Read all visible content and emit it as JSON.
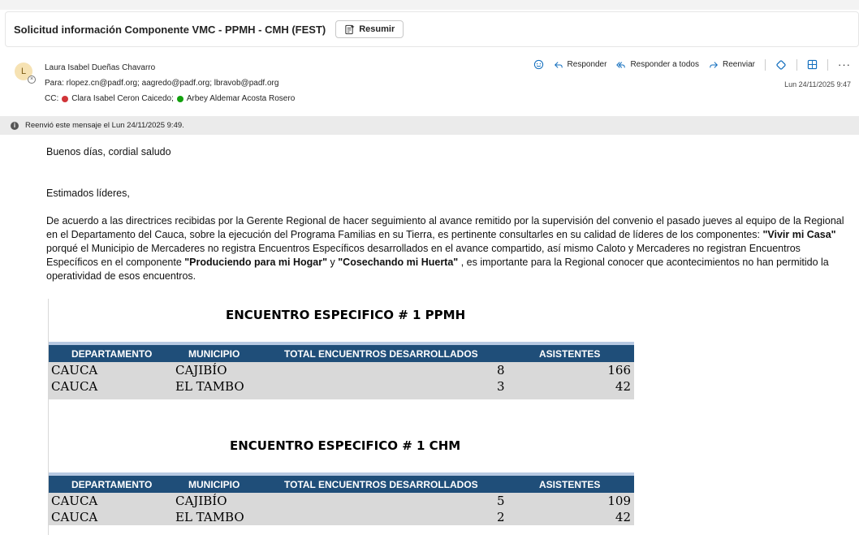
{
  "subject": "Solicitud información Componente VMC - PPMH - CMH (FEST)",
  "summarize_label": "Resumir",
  "sender": {
    "initial": "L",
    "name": "Laura Isabel Dueñas Chavarro",
    "to": "Para: rlopez.cn@padf.org;  aagredo@padf.org;  lbravob@padf.org",
    "cc_label": "CC:",
    "cc": [
      {
        "name": "Clara Isabel Ceron Caicedo;",
        "status": "#d13438"
      },
      {
        "name": "Arbey Aldemar Acosta Rosero",
        "status": "#13a10e"
      }
    ],
    "date": "Lun 24/11/2025 9:47"
  },
  "actions": {
    "reply": "Responder",
    "reply_all": "Responder a todos",
    "forward": "Reenviar"
  },
  "info_bar": "Reenvió este mensaje el Lun 24/11/2025 9:49.",
  "body": {
    "greeting": "Buenos días, cordial saludo",
    "salutation": "Estimados líderes,",
    "p_part1": "De acuerdo a las directrices recibidas por la Gerente Regional de hacer seguimiento al avance remitido por la supervisión del convenio el pasado jueves al equipo de la Regional en el Departamento del Cauca, sobre la ejecución del Programa Familias en su Tierra, es pertinente consultarles en su calidad de líderes de los componentes: ",
    "p_bold1": "\"Vivir mi Casa\"",
    "p_part2": " porqué el Municipio de Mercaderes no registra Encuentros Específicos desarrollados en el avance compartido, así mismo Caloto y Mercaderes no registran Encuentros Específicos en el componente ",
    "p_bold2": "\"Produciendo para mi Hogar\"",
    "p_part3": " y ",
    "p_bold3": "\"Cosechando mi Huerta\"",
    "p_part4": " , es importante para la Regional conocer que acontecimientos no han permitido la operatividad de esos encuentros."
  },
  "headers": [
    "DEPARTAMENTO",
    "MUNICIPIO",
    "TOTAL ENCUENTROS DESARROLLADOS",
    "ASISTENTES"
  ],
  "table1": {
    "title": "ENCUENTRO ESPECIFICO # 1 PPMH",
    "rows": [
      [
        "CAUCA",
        "CAJIBÍO",
        "8",
        "166"
      ],
      [
        "CAUCA",
        "EL TAMBO",
        "3",
        "42"
      ]
    ]
  },
  "table2": {
    "title": "ENCUENTRO ESPECIFICO # 1 CHM",
    "rows": [
      [
        "CAUCA",
        "CAJIBÍO",
        "5",
        "109"
      ],
      [
        "CAUCA",
        "EL TAMBO",
        "2",
        "42"
      ]
    ]
  }
}
